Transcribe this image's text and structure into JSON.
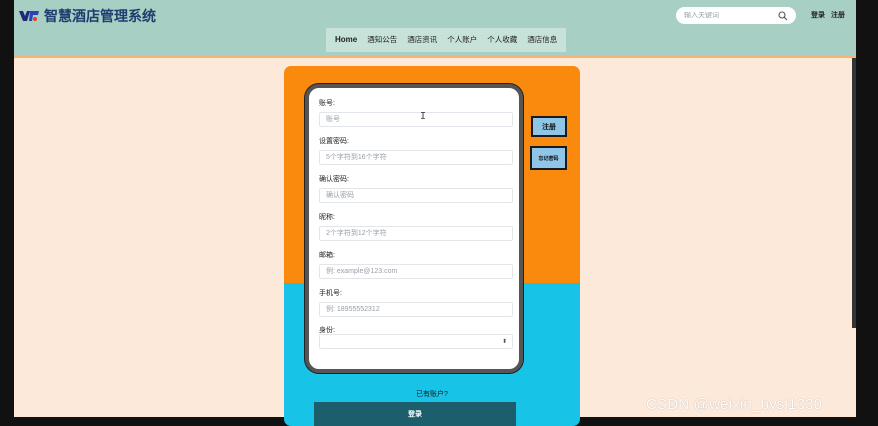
{
  "header": {
    "site_title": "智慧酒店管理系统",
    "search_placeholder": "输入关键词",
    "top_links": [
      "登录",
      "注册"
    ],
    "nav": [
      "Home",
      "酒知公告",
      "酒店资讯",
      "个人账户",
      "个人收藏",
      "酒店信息"
    ]
  },
  "form": {
    "fields": [
      {
        "label": "账号:",
        "placeholder": "账号"
      },
      {
        "label": "设置密码:",
        "placeholder": "5个字符到16个字符"
      },
      {
        "label": "确认密码:",
        "placeholder": "确认密码"
      },
      {
        "label": "昵称:",
        "placeholder": "2个字符到12个字符"
      },
      {
        "label": "邮箱:",
        "placeholder": "例: example@123.com"
      },
      {
        "label": "手机号:",
        "placeholder": "例: 18955552312"
      },
      {
        "label": "身份:",
        "value": ""
      }
    ],
    "register_side_label": "注册",
    "forgot_side_label": "忘记密码",
    "have_account_text": "已有账户?",
    "login_label": "登录"
  },
  "watermark": "CSDN @weixin_bysj1330",
  "colors": {
    "header_bg": "#a8cfc3",
    "page_bg": "#fde9d9",
    "card_orange": "#fa8a0e",
    "card_cyan": "#18c3e8",
    "login_button": "#1c5e6c",
    "side_button": "#8fc6e8"
  },
  "icons": {
    "logo": "hotel-logo-icon",
    "search": "search-icon",
    "select": "chevron-updown-icon",
    "cursor": "text-cursor-icon"
  }
}
